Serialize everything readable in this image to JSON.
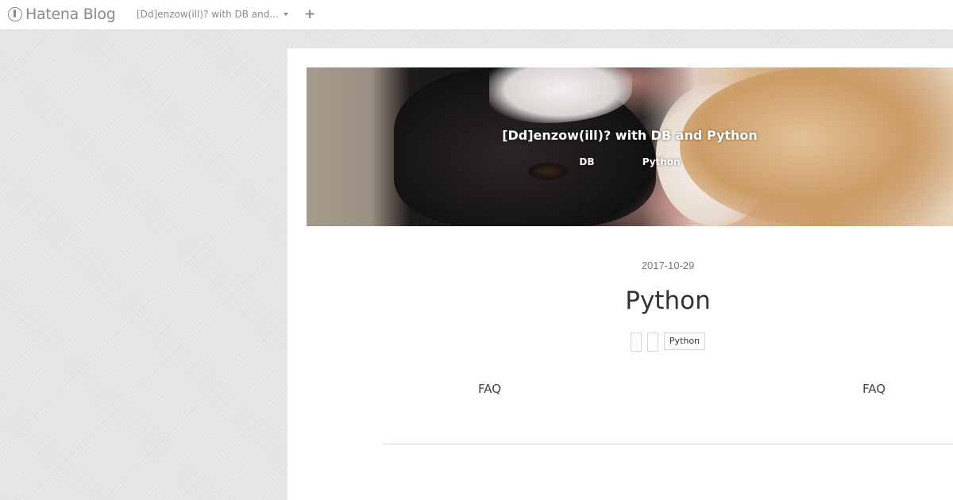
{
  "global_header": {
    "logo_text": "Hatena Blog",
    "blog_switcher_label": "[Dd]enzow(ill)? with DB and...",
    "icons": {
      "logo": "hatena-blog-logo-icon",
      "caret": "chevron-down-icon",
      "add": "plus-icon"
    }
  },
  "blog": {
    "title": "[Dd]enzow(ill)? with DB and Python",
    "description_items": [
      "DB",
      "Python"
    ]
  },
  "entry": {
    "date": "2017-10-29",
    "title": "Python",
    "categories": [
      "",
      "",
      "Python"
    ],
    "pager_left": "FAQ",
    "pager_right": "FAQ"
  },
  "colors": {
    "header_bg": "#ffffff",
    "logo_gray": "#8a8a8a",
    "page_bg": "#e5e5e5",
    "text_dark": "#333333"
  }
}
